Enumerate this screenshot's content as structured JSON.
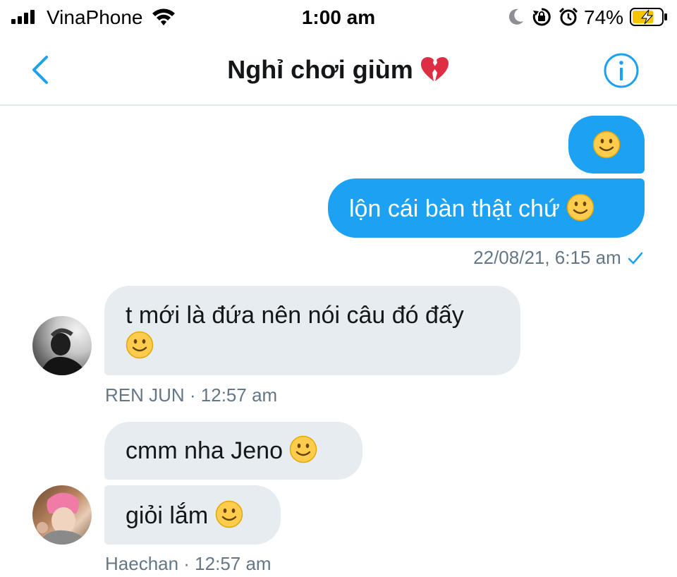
{
  "status_bar": {
    "carrier": "VinaPhone",
    "time": "1:00 am",
    "battery_percent": "74%",
    "battery_level": 0.74,
    "icons": [
      "signal-icon",
      "wifi-icon",
      "moon-icon",
      "rotation-lock-icon",
      "alarm-icon",
      "battery-charging-icon"
    ]
  },
  "header": {
    "title": "Nghỉ chơi giùm",
    "title_icon": "broken-heart-icon",
    "back_icon": "chevron-left-icon",
    "info_icon": "info-icon"
  },
  "messages": [
    {
      "direction": "outgoing",
      "text": "",
      "emoji": "slightly-smiling-face"
    },
    {
      "direction": "outgoing",
      "text": "lộn cái bàn thật chứ",
      "emoji": "slightly-smiling-face"
    },
    {
      "direction": "outgoing_meta",
      "timestamp": "22/08/21, 6:15 am",
      "status_icon": "checkmark-icon"
    },
    {
      "direction": "incoming",
      "text": "t mới là đứa nên nói câu đó đấy",
      "emoji": "slightly-smiling-face"
    },
    {
      "direction": "incoming_meta",
      "meta": "REN JUN · 12:57 am"
    },
    {
      "direction": "incoming",
      "text": "cmm nha Jeno",
      "emoji": "slightly-smiling-face"
    },
    {
      "direction": "incoming",
      "text": "giỏi lắm",
      "emoji": "slightly-smiling-face"
    },
    {
      "direction": "incoming_meta",
      "meta": "Haechan · 12:57 am"
    }
  ],
  "colors": {
    "accent": "#1da1f2",
    "incoming_bubble": "#e6ecf0",
    "meta_text": "#657786",
    "divider": "#e1e8ed"
  }
}
